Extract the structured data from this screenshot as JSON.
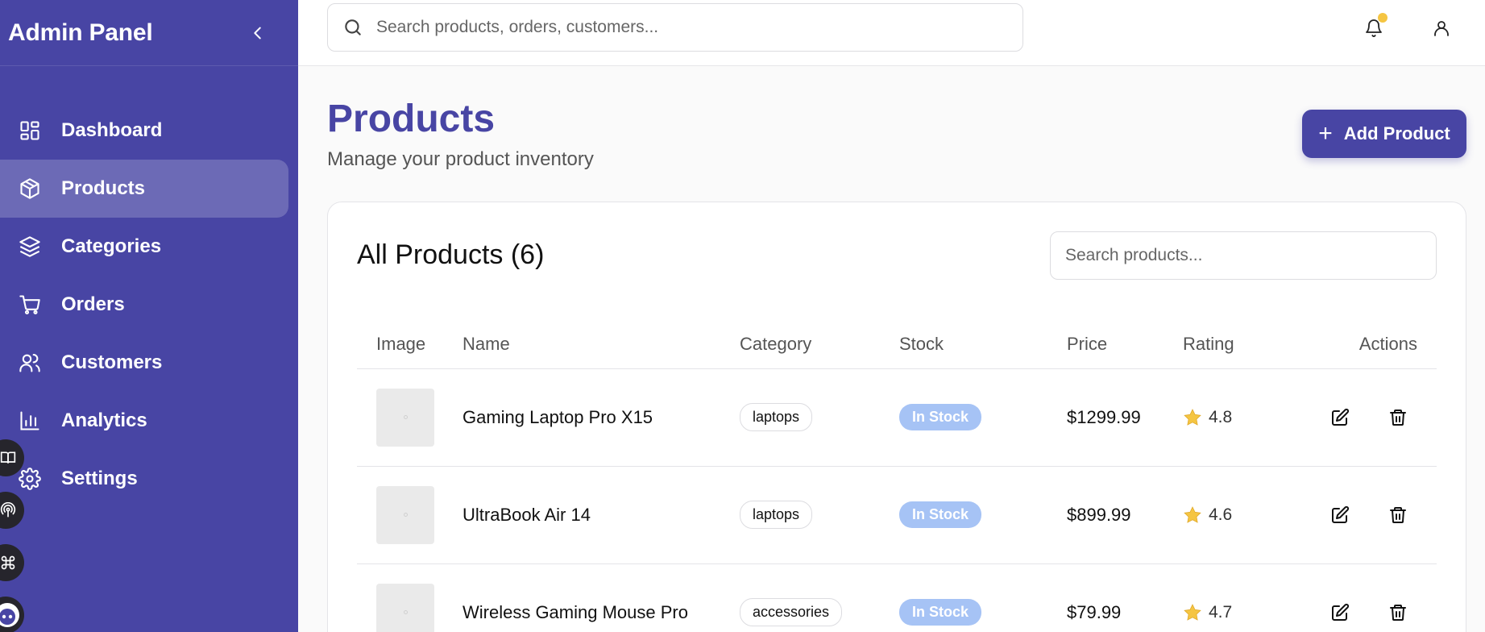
{
  "sidebar": {
    "title": "Admin Panel",
    "items": [
      {
        "label": "Dashboard",
        "icon": "dashboard-icon",
        "active": false
      },
      {
        "label": "Products",
        "icon": "package-icon",
        "active": true
      },
      {
        "label": "Categories",
        "icon": "layers-icon",
        "active": false
      },
      {
        "label": "Orders",
        "icon": "cart-icon",
        "active": false
      },
      {
        "label": "Customers",
        "icon": "users-icon",
        "active": false
      },
      {
        "label": "Analytics",
        "icon": "bar-chart-icon",
        "active": false
      },
      {
        "label": "Settings",
        "icon": "gear-icon",
        "active": false
      }
    ]
  },
  "header": {
    "search_placeholder": "Search products, orders, customers..."
  },
  "page": {
    "title": "Products",
    "subtitle": "Manage your product inventory",
    "add_label": "Add Product"
  },
  "products_card": {
    "title": "All Products (6)",
    "search_placeholder": "Search products...",
    "columns": [
      "Image",
      "Name",
      "Category",
      "Stock",
      "Price",
      "Rating",
      "Actions"
    ],
    "rows": [
      {
        "name": "Gaming Laptop Pro X15",
        "category": "laptops",
        "stock": "In Stock",
        "price": "$1299.99",
        "rating": "4.8"
      },
      {
        "name": "UltraBook Air 14",
        "category": "laptops",
        "stock": "In Stock",
        "price": "$899.99",
        "rating": "4.6"
      },
      {
        "name": "Wireless Gaming Mouse Pro",
        "category": "accessories",
        "stock": "In Stock",
        "price": "$79.99",
        "rating": "4.7"
      }
    ]
  },
  "colors": {
    "brand": "#4845a4",
    "stock_badge": "#a6c3f5",
    "star": "#f5c542",
    "notification_dot": "#f5c542"
  }
}
